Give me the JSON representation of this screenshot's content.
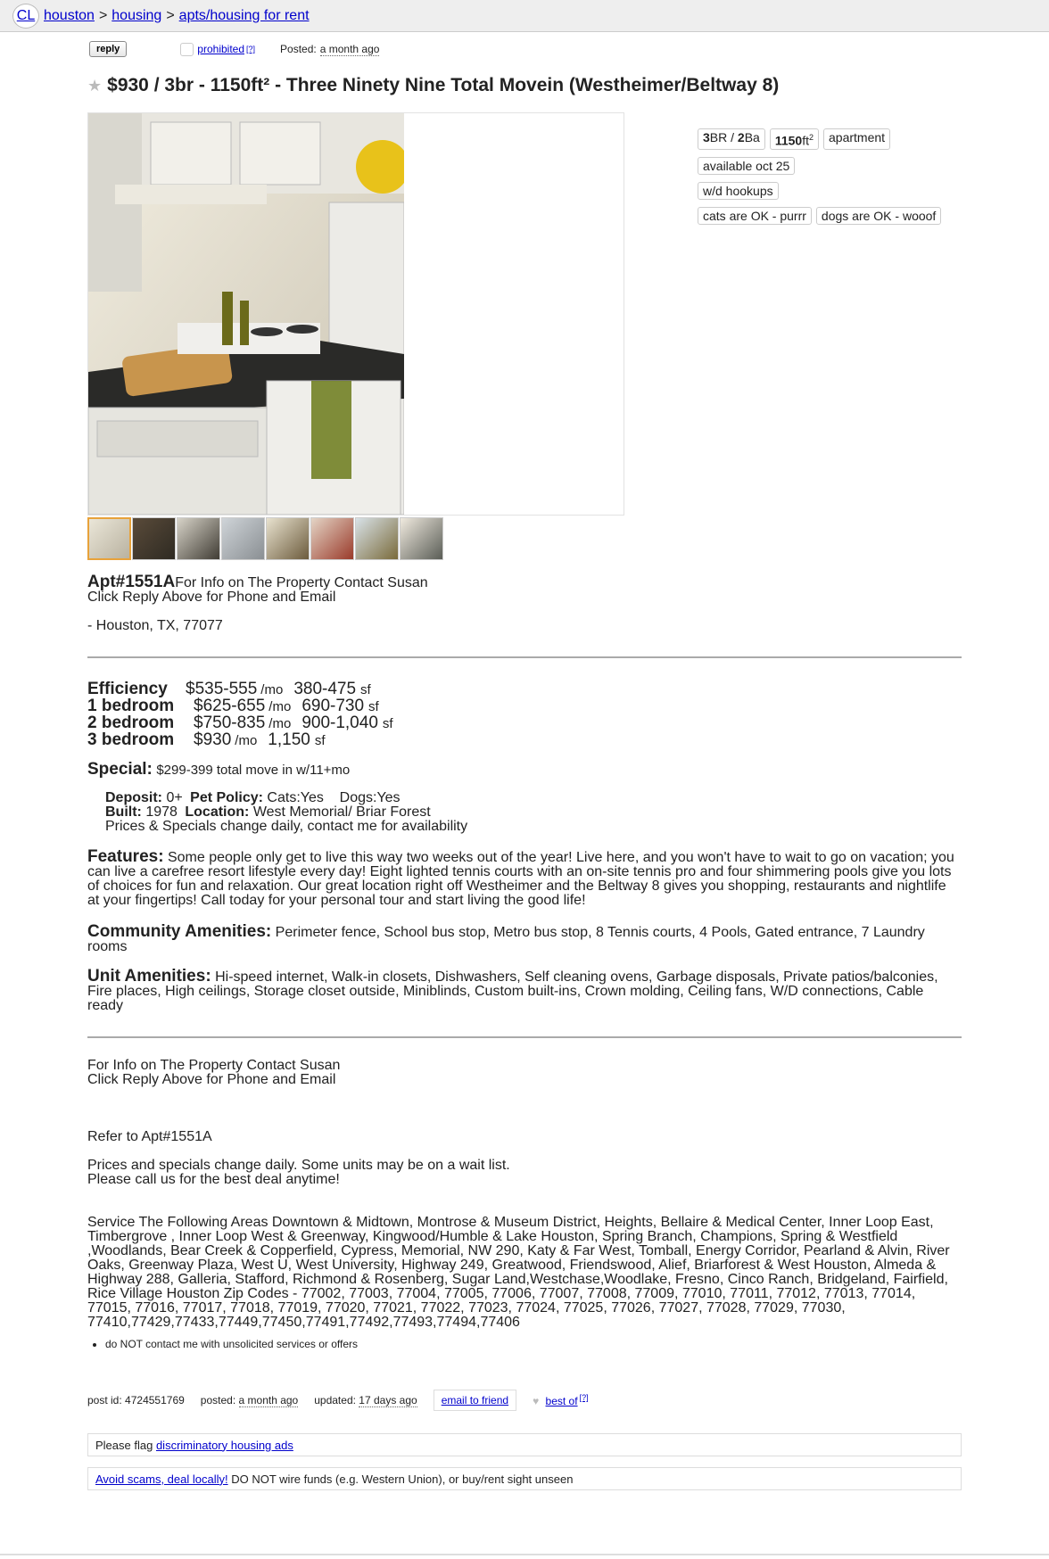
{
  "breadcrumb": {
    "logo": "CL",
    "items": [
      "houston",
      "housing",
      "apts/housing for rent"
    ],
    "sep": ">"
  },
  "actions": {
    "reply": "reply",
    "prohibited": "prohibited",
    "help_mark": "[?]",
    "posted_label": "Posted:",
    "posted_value": "a month ago"
  },
  "title": "$930 / 3br - 1150ft² - Three Ninety Nine Total Movein (Westheimer/Beltway 8)",
  "attributes": {
    "br_num": "3",
    "br_lbl": "BR / ",
    "ba_num": "2",
    "ba_lbl": "Ba",
    "sqft_num": "1150",
    "sqft_lbl": "ft",
    "sqft_sup": "2",
    "type": "apartment",
    "available": "available oct 25",
    "laundry": "w/d hookups",
    "cats": "cats are OK - purrr",
    "dogs": "dogs are OK - wooof"
  },
  "intro": {
    "apt": "Apt#1551A",
    "line1": "For Info on The Property Contact Susan",
    "line2": "Click Reply Above for Phone and Email",
    "location": "- Houston, TX, 77077"
  },
  "units": [
    {
      "name": "Efficiency",
      "price": "$535-555",
      "per": "/mo",
      "size": "380-475",
      "sf": "sf"
    },
    {
      "name": "1 bedroom",
      "price": "$625-655",
      "per": "/mo",
      "size": "690-730",
      "sf": "sf"
    },
    {
      "name": "2 bedroom",
      "price": "$750-835",
      "per": "/mo",
      "size": "900-1,040",
      "sf": "sf"
    },
    {
      "name": "3 bedroom",
      "price": "$930",
      "per": "/mo",
      "size": "1,150",
      "sf": "sf"
    }
  ],
  "special": {
    "label": "Special:",
    "text": "$299-399 total move in w/11+mo"
  },
  "details": {
    "deposit_lbl": "Deposit:",
    "deposit_val": "0+",
    "pet_lbl": "Pet Policy:",
    "pet_val": "Cats:Yes    Dogs:Yes",
    "built_lbl": "Built:",
    "built_val": "1978",
    "loc_lbl": "Location:",
    "loc_val": "West Memorial/ Briar Forest",
    "note": "Prices & Specials change daily, contact me for availability"
  },
  "features": {
    "label": "Features:",
    "text": "Some people only get to live this way two weeks out of the year! Live here, and you won't have to wait to go on vacation; you can live a carefree resort lifestyle every day! Eight lighted tennis courts with an on-site tennis pro and four shimmering pools give you lots of choices for fun and relaxation. Our great location right off Westheimer and the Beltway 8 gives you shopping, restaurants and nightlife at your fingertips! Call today for your personal tour and start living the good life!"
  },
  "community": {
    "label": "Community Amenities:",
    "text": "Perimeter fence, School bus stop, Metro bus stop, 8 Tennis courts, 4 Pools, Gated entrance, 7 Laundry rooms"
  },
  "unit_amenities": {
    "label": "Unit Amenities:",
    "text": "Hi-speed internet, Walk-in closets, Dishwashers, Self cleaning ovens, Garbage disposals, Private patios/balconies, Fire places, High ceilings, Storage closet outside, Miniblinds, Custom built-ins, Crown molding, Ceiling fans, W/D connections, Cable ready"
  },
  "contact": {
    "line1": "For Info on The Property Contact Susan",
    "line2": "Click Reply Above for Phone and Email",
    "refer": "Refer to Apt#1551A",
    "prices1": "Prices and specials change daily. Some units may be on a wait list.",
    "prices2": "Please call us for the best deal anytime!"
  },
  "service_areas": "Service The Following Areas Downtown & Midtown, Montrose & Museum District, Heights, Bellaire & Medical Center, Inner Loop East, Timbergrove , Inner Loop West & Greenway, Kingwood/Humble & Lake Houston, Spring Branch, Champions, Spring & Westfield ,Woodlands, Bear Creek & Copperfield, Cypress, Memorial, NW 290, Katy & Far West, Tomball, Energy Corridor, Pearland & Alvin, River Oaks, Greenway Plaza, West U, West University, Highway 249, Greatwood, Friendswood, Alief, Briarforest & West Houston, Almeda & Highway 288, Galleria, Stafford, Richmond & Rosenberg, Sugar Land,Westchase,Woodlake, Fresno, Cinco Ranch, Bridgeland, Fairfield, Rice Village Houston Zip Codes - 77002, 77003, 77004, 77005, 77006, 77007, 77008, 77009, 77010, 77011, 77012, 77013, 77014, 77015, 77016, 77017, 77018, 77019, 77020, 77021, 77022, 77023, 77024, 77025, 77026, 77027, 77028, 77029, 77030, 77410,77429,77433,77449,77450,77491,77492,77493,77494,77406",
  "notice_item": "do NOT contact me with unsolicited services or offers",
  "footer": {
    "post_id_label": "post id:",
    "post_id": "4724551769",
    "posted_label": "posted:",
    "posted_value": "a month ago",
    "updated_label": "updated:",
    "updated_value": "17 days ago",
    "email_friend": "email to friend",
    "best_of": "best of",
    "help_mark": "[?]"
  },
  "flag_notice": {
    "prefix": "Please flag",
    "link": "discriminatory housing ads"
  },
  "scam_notice": {
    "link": "Avoid scams, deal locally!",
    "text": "DO NOT wire funds (e.g. Western Union), or buy/rent sight unseen"
  }
}
